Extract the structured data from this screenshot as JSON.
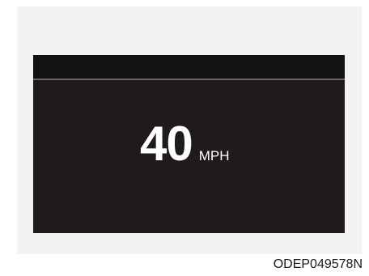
{
  "display": {
    "speed_value": "40",
    "speed_unit": "MPH"
  },
  "figure_code": "ODEP049578N",
  "colors": {
    "display_background": "#1f1b1b",
    "display_text": "#ffffff",
    "frame_background": "#f2f2f2"
  }
}
